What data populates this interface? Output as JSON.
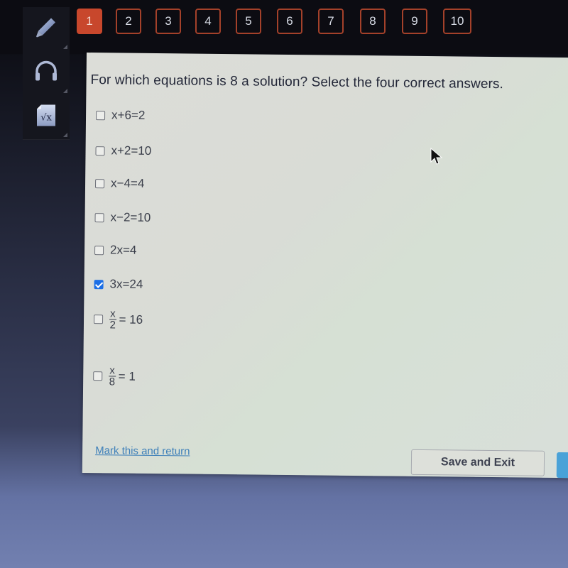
{
  "toolbar": {
    "tools": [
      {
        "name": "pencil",
        "icon": "pencil-icon"
      },
      {
        "name": "audio",
        "icon": "headphones-icon"
      },
      {
        "name": "math",
        "icon": "square-root-icon",
        "label": "√x"
      }
    ]
  },
  "question_nav": {
    "current": 1,
    "items": [
      "1",
      "2",
      "3",
      "4",
      "5",
      "6",
      "7",
      "8",
      "9",
      "10"
    ],
    "accent_color": "#c8472c"
  },
  "question": {
    "prompt": "For which equations is 8 a solution? Select the four correct answers.",
    "options": [
      {
        "text": "x+6=2",
        "checked": false
      },
      {
        "text": "x+2=10",
        "checked": false
      },
      {
        "text": "x−4=4",
        "checked": false
      },
      {
        "text": "x−2=10",
        "checked": false
      },
      {
        "text": "2x=4",
        "checked": false
      },
      {
        "text": "3x=24",
        "checked": true
      },
      {
        "numerator": "x",
        "denominator": "2",
        "rhs": "= 16",
        "checked": false
      },
      {
        "numerator": "x",
        "denominator": "8",
        "rhs": "= 1",
        "checked": false
      }
    ]
  },
  "footer": {
    "mark_link": "Mark this and return",
    "save_button": "Save and Exit"
  }
}
